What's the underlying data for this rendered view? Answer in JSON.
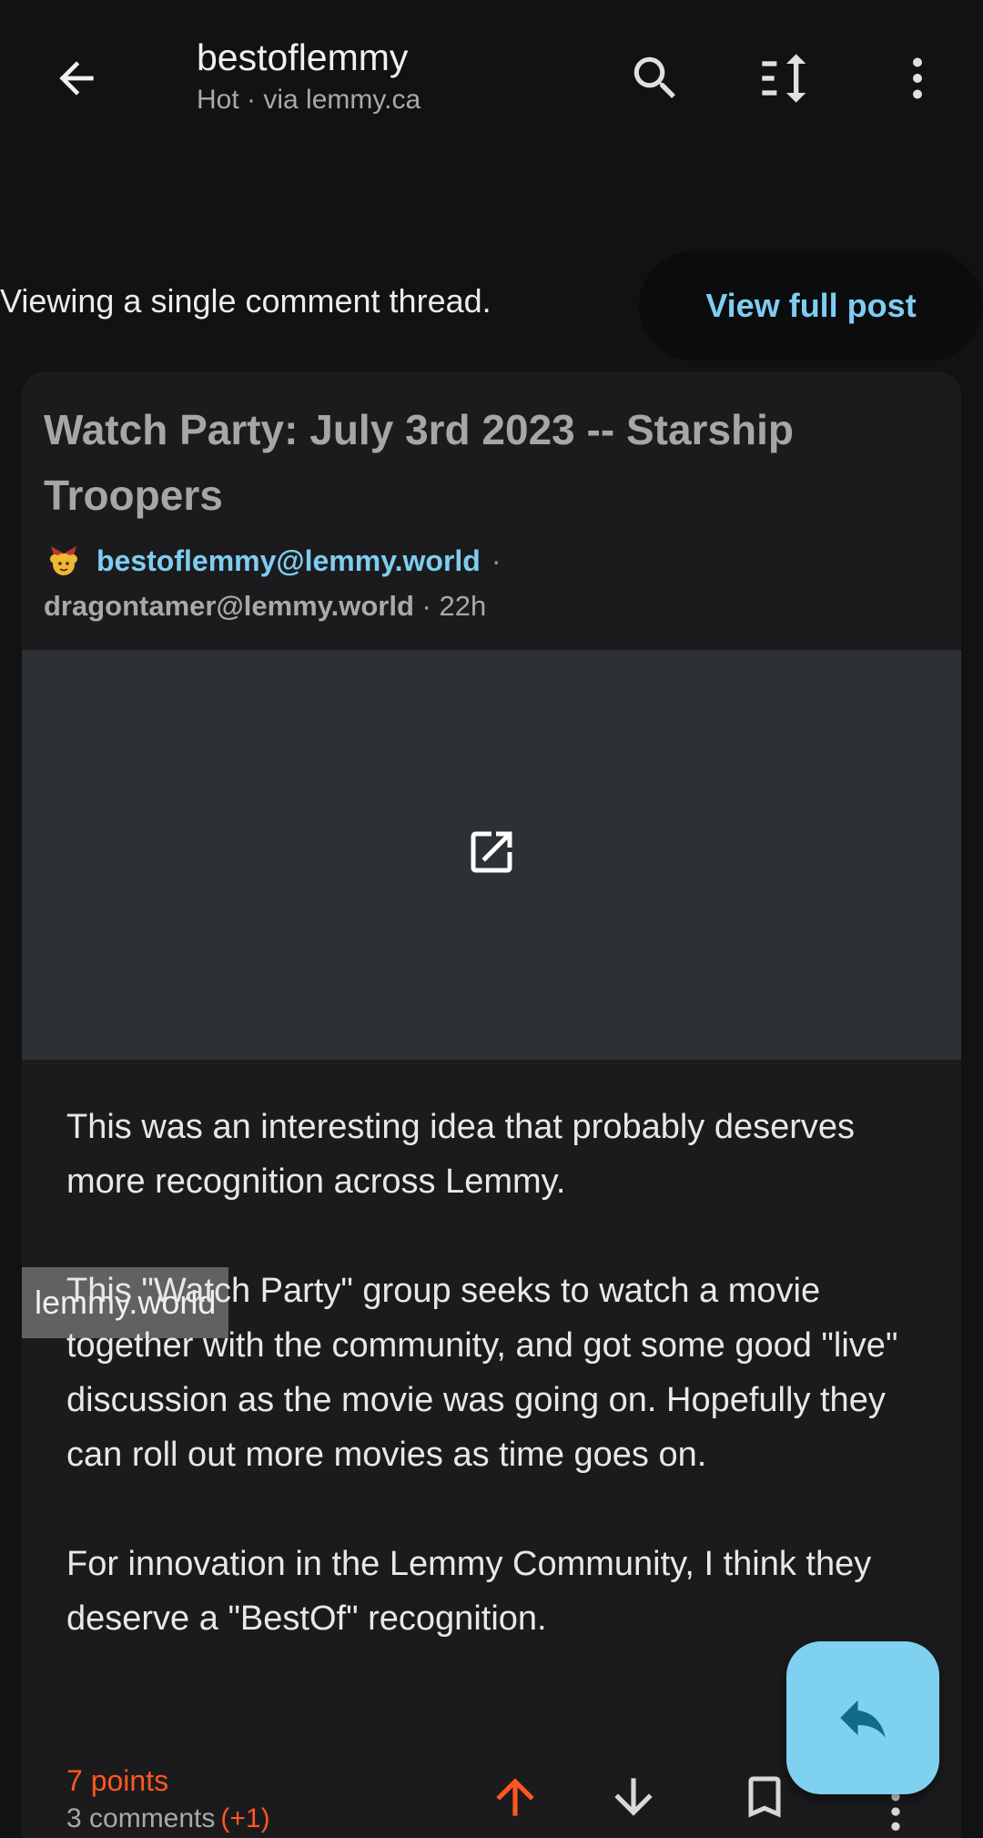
{
  "header": {
    "title": "bestoflemmy",
    "subtitle": "Hot · via lemmy.ca",
    "icons": [
      "back-arrow-icon",
      "search-icon",
      "sort-icon",
      "more-vert-icon"
    ]
  },
  "thread_banner": {
    "text": "Viewing a single comment thread.",
    "button_label": "View full post"
  },
  "post": {
    "title": "Watch Party: July 3rd 2023 -- Starship Troopers",
    "community": "bestoflemmy@lemmy.world",
    "author": "dragontamer@lemmy.world",
    "age": "22h",
    "link_domain": "lemmy.world",
    "body": [
      "This was an interesting idea that probably deserves more recognition across Lemmy.",
      "This \"Watch Party\" group seeks to watch a movie together with the community, and got some good \"live\" discussion as the movie was going on. Hopefully they can roll out more movies as time goes on.",
      "For innovation in the Lemmy Community, I think they deserve a \"BestOf\" recognition."
    ],
    "points": "7 points",
    "comments": "3 comments",
    "new_comments": "(+1)"
  },
  "colors": {
    "accent": "#7fcdf1",
    "upvote": "#ff5722",
    "background": "#111214",
    "card": "#1b1b1d"
  }
}
